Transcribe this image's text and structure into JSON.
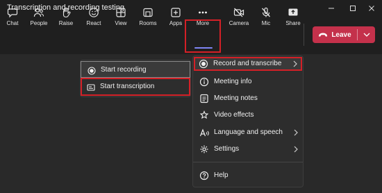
{
  "window": {
    "title": "Transcription and recording testing"
  },
  "toolbar": {
    "chat": "Chat",
    "people": "People",
    "raise": "Raise",
    "react": "React",
    "view": "View",
    "rooms": "Rooms",
    "apps": "Apps",
    "more": "More",
    "camera": "Camera",
    "mic": "Mic",
    "share": "Share",
    "leave": "Leave"
  },
  "more_menu": {
    "items": [
      {
        "label": "Record and transcribe",
        "icon": "record-icon",
        "has_submenu": true
      },
      {
        "label": "Meeting info",
        "icon": "info-icon",
        "has_submenu": false
      },
      {
        "label": "Meeting notes",
        "icon": "notes-icon",
        "has_submenu": false
      },
      {
        "label": "Video effects",
        "icon": "video-effects-icon",
        "has_submenu": false
      },
      {
        "label": "Language and speech",
        "icon": "language-icon",
        "has_submenu": true
      },
      {
        "label": "Settings",
        "icon": "gear-icon",
        "has_submenu": true
      },
      {
        "label": "Help",
        "icon": "help-icon",
        "has_submenu": false
      }
    ]
  },
  "record_submenu": {
    "items": [
      {
        "label": "Start recording",
        "icon": "record-icon"
      },
      {
        "label": "Start transcription",
        "icon": "transcript-icon"
      }
    ]
  },
  "colors": {
    "highlight_border": "#d42027",
    "leave_button": "#c4314b",
    "accent_underline": "#7f85f5",
    "background": "#292929"
  }
}
